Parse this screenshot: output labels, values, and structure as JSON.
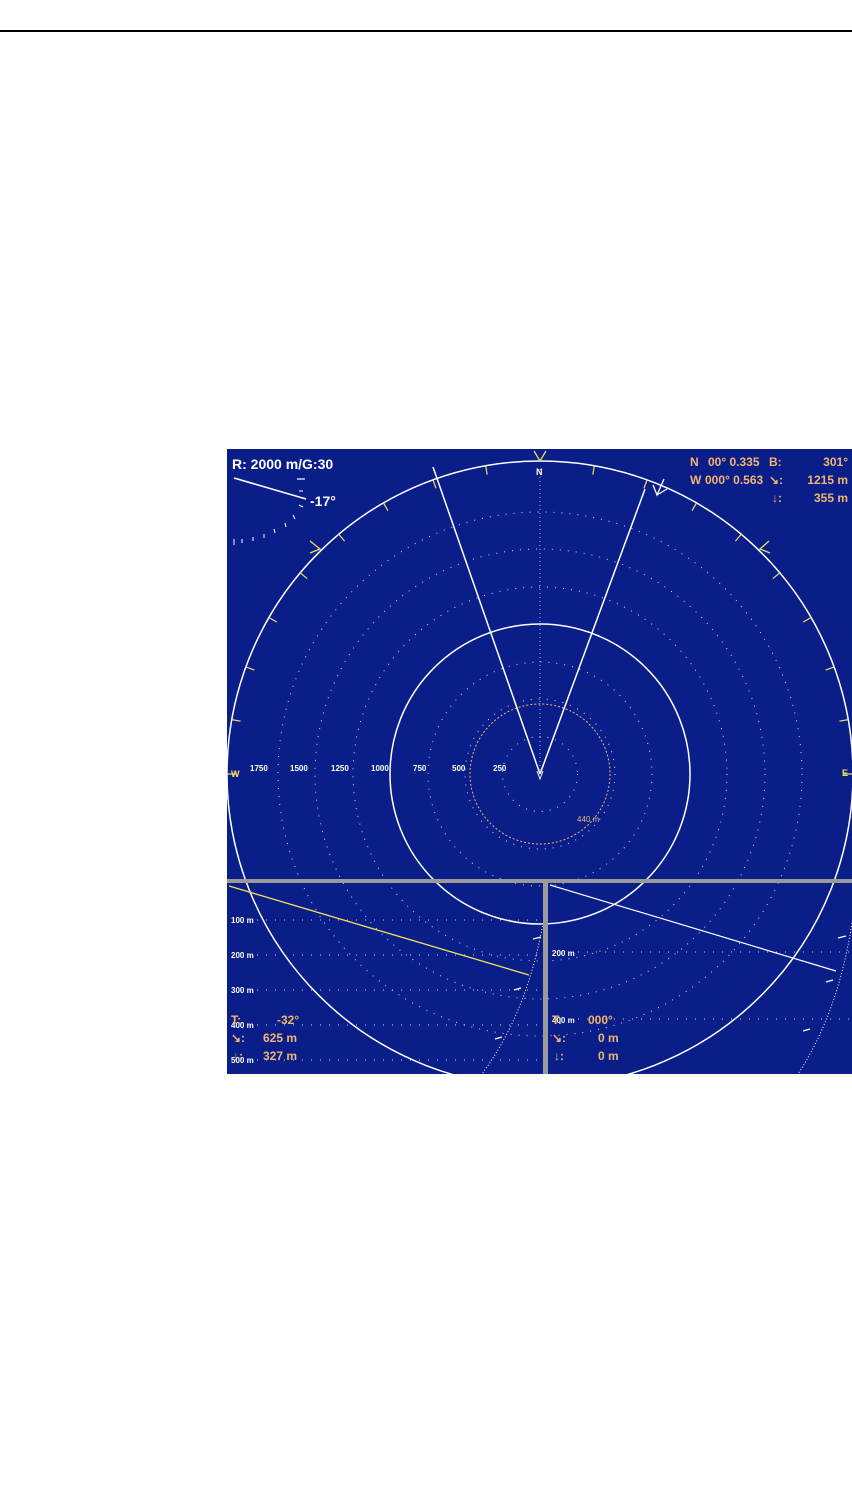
{
  "header": {
    "rule": true
  },
  "sonar": {
    "range_gain": "R: 2000 m/G:30",
    "tilt": "-17°",
    "compass": {
      "north": "N",
      "west": "W",
      "east": "E"
    },
    "scale_labels": [
      "1750",
      "1500",
      "1250",
      "1000",
      "750",
      "500",
      "250"
    ],
    "target_distance": "440 m",
    "position": {
      "lat_label": "N",
      "lat_value": "00° 0.335",
      "lon_label": "W",
      "lon_value": "000° 0.563",
      "bearing_label": "B:",
      "bearing_value": "301°",
      "dist_icon": "↘:",
      "dist_value": "1215 m",
      "depth_icon": "↓:",
      "depth_value": "355 m"
    },
    "colors": {
      "background": "#0a1e8a",
      "text_orange": "#f2b56e",
      "marker_yellow": "#f2e05a",
      "lines": "#ffffff"
    }
  },
  "left_panel": {
    "depth_labels": [
      "100 m",
      "200 m",
      "300 m",
      "400 m",
      "500 m"
    ],
    "tilt_label": "T:",
    "tilt_value": "-32°",
    "dist_icon": "↘:",
    "dist_value": "625 m",
    "depth_icon": "↓:",
    "depth_value": "327 m"
  },
  "right_panel": {
    "depth_labels": [
      "200 m",
      "400 m"
    ],
    "tilt_label": "T:",
    "tilt_value": "000°",
    "dist_icon": "↘:",
    "dist_value": "0 m",
    "depth_icon": "↓:",
    "depth_value": "0 m"
  }
}
